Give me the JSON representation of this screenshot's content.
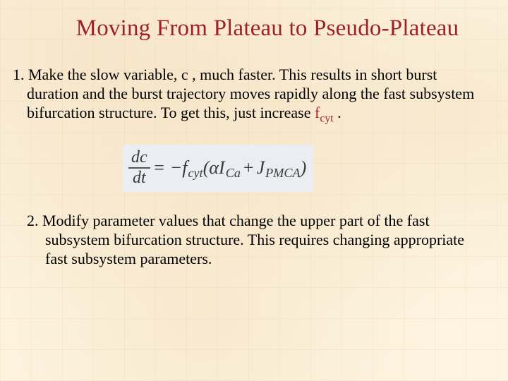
{
  "title": "Moving From Plateau to Pseudo-Plateau",
  "item1": {
    "num": "1.",
    "pre": " Make the slow variable, c , much faster. This results in short burst duration and the burst trajectory moves rapidly along the fast subsystem bifurcation structure. To get this, just increase ",
    "hvar": "f",
    "hsub": "cyt",
    "post": " ."
  },
  "equation": {
    "dc": "dc",
    "dt": "dt",
    "eqsym": " = ",
    "minus": "−",
    "f": "f",
    "fsub": "cyt",
    "lpar": "(",
    "alpha": "α",
    "I": "I",
    "Isub": "Ca",
    "plus": "+",
    "J": "J",
    "Jsub": "PMCA",
    "rpar": ")"
  },
  "item2": {
    "num": "2.",
    "body": "  Modify parameter values that change the upper part of the fast subsystem bifurcation structure. This requires changing appropriate fast subsystem parameters."
  }
}
